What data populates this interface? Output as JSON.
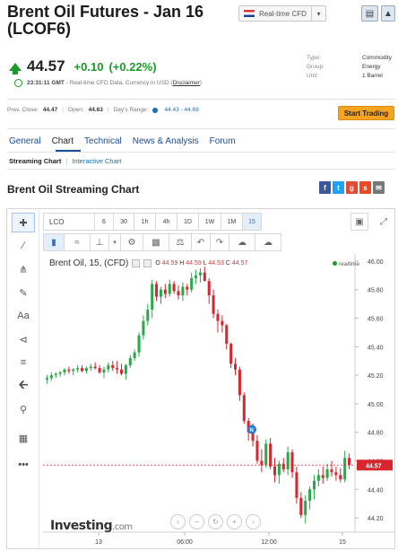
{
  "header": {
    "title": "Brent Oil Futures - Jan 16 (LCOF6)",
    "cfd_dropdown": "Real-time CFD"
  },
  "quote": {
    "last": "44.57",
    "change": "+0.10",
    "change_pct": "(+0.22%)",
    "status_time": "23:31:11 GMT",
    "status_text": "- Real-time CFD Data. Currency in USD (",
    "disclaimer": "Disclaimer",
    "status_close": ")"
  },
  "info": [
    {
      "label": "Type:",
      "value": "Commodity"
    },
    {
      "label": "Group:",
      "value": "Energy"
    },
    {
      "label": "Unit:",
      "value": "1 Barrel"
    }
  ],
  "stats": {
    "prev_close_label": "Prev. Close:",
    "prev_close": "44.47",
    "open_label": "Open:",
    "open": "44.63",
    "range_label": "Day's Range:",
    "range": "44.43 - 44.69"
  },
  "start_trading": "Start Trading",
  "tabs": [
    "General",
    "Chart",
    "Technical",
    "News & Analysis",
    "Forum"
  ],
  "subtabs": {
    "streaming": "Streaming Chart",
    "sep": "|",
    "interactive": "Interactive Chart"
  },
  "section_title": "Brent Oil Streaming Chart",
  "toolbar": {
    "symbol": "LCO",
    "intervals": [
      "6",
      "30",
      "1h",
      "4h",
      "1D",
      "1W",
      "1M",
      "15"
    ]
  },
  "legend": {
    "name": "Brent Oil, 15, (CFD)",
    "o_label": "O",
    "o": "44.59",
    "h_label": "H",
    "h": "44.59",
    "l_label": "L",
    "l": "44.53",
    "c_label": "C",
    "c": "44.57",
    "realtime": "realtime"
  },
  "logo": {
    "main": "Investing",
    "suffix": ".com"
  },
  "colors": {
    "up": "#2aa84a",
    "down": "#d8262f",
    "accent": "#f7a521",
    "link": "#1a4d99"
  },
  "chart_data": {
    "type": "candlestick",
    "y_ticks": [
      "46.00",
      "45.80",
      "45.60",
      "45.40",
      "45.20",
      "45.00",
      "44.80",
      "44.60",
      "44.40",
      "44.20"
    ],
    "x_ticks": [
      "13",
      "06:00",
      "12:00",
      "15"
    ],
    "ylim": [
      44.1,
      46.05
    ],
    "current_price": "44.57",
    "candles": [
      [
        45.17,
        45.2,
        45.14,
        45.18
      ],
      [
        45.18,
        45.22,
        45.16,
        45.2
      ],
      [
        45.2,
        45.22,
        45.18,
        45.21
      ],
      [
        45.21,
        45.23,
        45.19,
        45.22
      ],
      [
        45.22,
        45.25,
        45.2,
        45.24
      ],
      [
        45.24,
        45.26,
        45.21,
        45.23
      ],
      [
        45.23,
        45.25,
        45.2,
        45.24
      ],
      [
        45.24,
        45.27,
        45.22,
        45.25
      ],
      [
        45.25,
        45.27,
        45.22,
        45.23
      ],
      [
        45.23,
        45.26,
        45.21,
        45.25
      ],
      [
        45.25,
        45.28,
        45.23,
        45.26
      ],
      [
        45.26,
        45.29,
        45.24,
        45.25
      ],
      [
        45.25,
        45.27,
        45.21,
        45.22
      ],
      [
        45.22,
        45.26,
        45.18,
        45.24
      ],
      [
        45.24,
        45.29,
        45.22,
        45.27
      ],
      [
        45.27,
        45.3,
        45.23,
        45.25
      ],
      [
        45.25,
        45.3,
        45.21,
        45.24
      ],
      [
        45.24,
        45.28,
        45.2,
        45.21
      ],
      [
        45.21,
        45.28,
        45.17,
        45.27
      ],
      [
        45.27,
        45.34,
        45.25,
        45.32
      ],
      [
        45.32,
        45.38,
        45.3,
        45.36
      ],
      [
        45.36,
        45.5,
        45.33,
        45.48
      ],
      [
        45.48,
        45.62,
        45.45,
        45.58
      ],
      [
        45.58,
        45.7,
        45.55,
        45.66
      ],
      [
        45.66,
        45.87,
        45.6,
        45.84
      ],
      [
        45.84,
        45.86,
        45.72,
        45.75
      ],
      [
        45.75,
        45.82,
        45.7,
        45.8
      ],
      [
        45.8,
        45.84,
        45.74,
        45.77
      ],
      [
        45.77,
        45.87,
        45.75,
        45.84
      ],
      [
        45.84,
        45.86,
        45.77,
        45.79
      ],
      [
        45.79,
        45.83,
        45.73,
        45.76
      ],
      [
        45.76,
        45.85,
        45.72,
        45.82
      ],
      [
        45.82,
        45.84,
        45.76,
        45.8
      ],
      [
        45.8,
        45.92,
        45.78,
        45.88
      ],
      [
        45.88,
        45.94,
        45.84,
        45.9
      ],
      [
        45.9,
        45.95,
        45.85,
        45.92
      ],
      [
        45.92,
        45.96,
        45.86,
        45.86
      ],
      [
        45.86,
        45.88,
        45.7,
        45.76
      ],
      [
        45.76,
        45.8,
        45.6,
        45.63
      ],
      [
        45.63,
        45.66,
        45.5,
        45.58
      ],
      [
        45.58,
        45.62,
        45.5,
        45.55
      ],
      [
        45.55,
        45.56,
        45.38,
        45.42
      ],
      [
        45.42,
        45.43,
        45.25,
        45.28
      ],
      [
        45.28,
        45.32,
        45.2,
        45.24
      ],
      [
        45.24,
        45.26,
        45.02,
        45.06
      ],
      [
        45.06,
        45.08,
        44.86,
        44.88
      ],
      [
        44.88,
        44.9,
        44.74,
        44.8
      ],
      [
        44.8,
        44.86,
        44.7,
        44.74
      ],
      [
        44.74,
        44.78,
        44.58,
        44.6
      ],
      [
        44.6,
        44.68,
        44.52,
        44.57
      ],
      [
        44.57,
        44.75,
        44.55,
        44.72
      ],
      [
        44.72,
        44.76,
        44.54,
        44.56
      ],
      [
        44.56,
        44.62,
        44.45,
        44.5
      ],
      [
        44.5,
        44.6,
        44.44,
        44.58
      ],
      [
        44.58,
        44.62,
        44.52,
        44.54
      ],
      [
        44.54,
        44.7,
        44.5,
        44.66
      ],
      [
        44.66,
        44.68,
        44.48,
        44.52
      ],
      [
        44.52,
        44.56,
        44.3,
        44.34
      ],
      [
        44.34,
        44.38,
        44.2,
        44.22
      ],
      [
        44.22,
        44.36,
        44.16,
        44.32
      ],
      [
        44.32,
        44.42,
        44.26,
        44.4
      ],
      [
        44.4,
        44.5,
        44.33,
        44.46
      ],
      [
        44.46,
        44.54,
        44.42,
        44.5
      ],
      [
        44.5,
        44.56,
        44.44,
        44.48
      ],
      [
        44.48,
        44.58,
        44.46,
        44.54
      ],
      [
        44.54,
        44.6,
        44.49,
        44.52
      ],
      [
        44.52,
        44.56,
        44.46,
        44.5
      ],
      [
        44.5,
        44.55,
        44.45,
        44.47
      ],
      [
        44.47,
        44.67,
        44.45,
        44.62
      ],
      [
        44.62,
        44.65,
        44.54,
        44.57
      ]
    ]
  }
}
